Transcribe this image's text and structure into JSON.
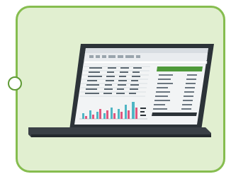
{
  "illustration": {
    "subject": "laptop-with-spreadsheet",
    "colors": {
      "card_background": "#e1efd0",
      "card_border": "#86bd4f",
      "connector_border": "#5f9a35",
      "laptop_body": "#2c3338",
      "laptop_base": "#3a4046",
      "screen_header": "#4f9a3a",
      "chart_bars_teal": "#4fb6c4",
      "chart_bars_pink": "#e0577e"
    }
  }
}
